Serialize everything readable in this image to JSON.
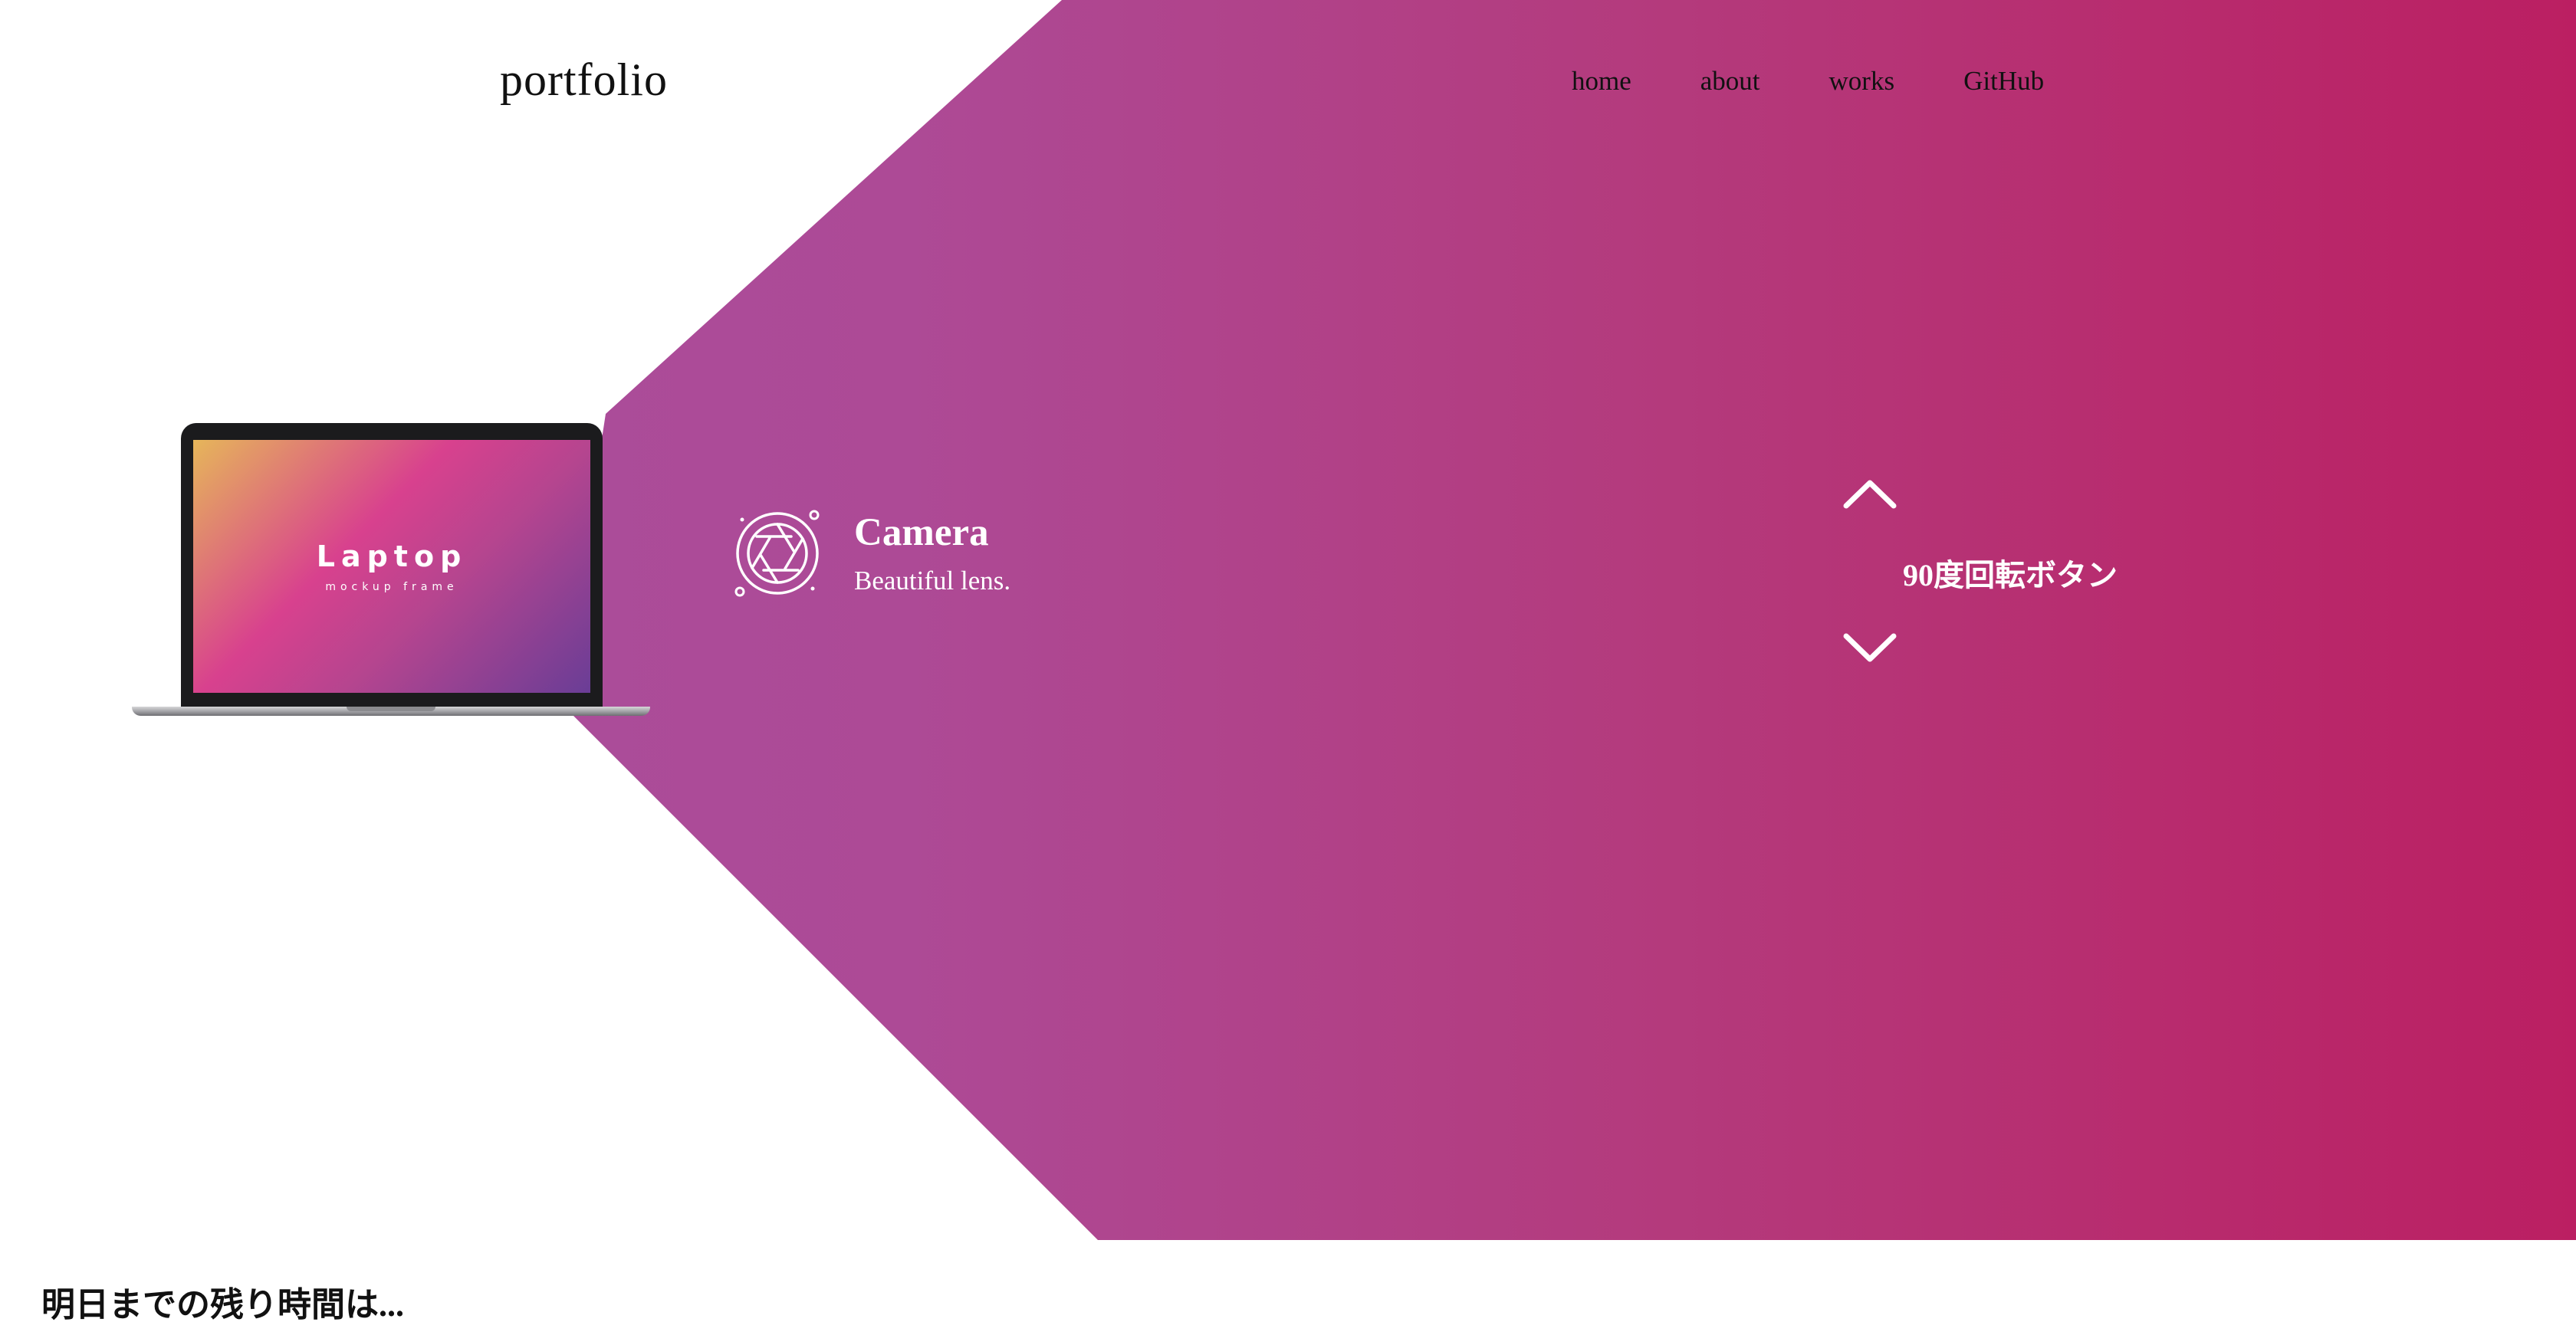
{
  "header": {
    "logo": "portfolio",
    "nav": [
      "home",
      "about",
      "works",
      "GitHub"
    ]
  },
  "hero": {
    "laptop": {
      "title": "Laptop",
      "subtitle": "mockup frame"
    },
    "feature": {
      "icon": "camera-aperture-icon",
      "title": "Camera",
      "subtitle": "Beautiful lens."
    },
    "rotate_button": {
      "label": "90度回転ボタン",
      "up_icon": "chevron-up-icon",
      "down_icon": "chevron-down-icon"
    }
  },
  "footer_section": {
    "countdown_heading": "明日までの残り時間は..."
  },
  "colors": {
    "gradient_start": "#a74f9f",
    "gradient_end": "#bb1f62",
    "text_dark": "#111111",
    "text_light": "#ffffff"
  }
}
